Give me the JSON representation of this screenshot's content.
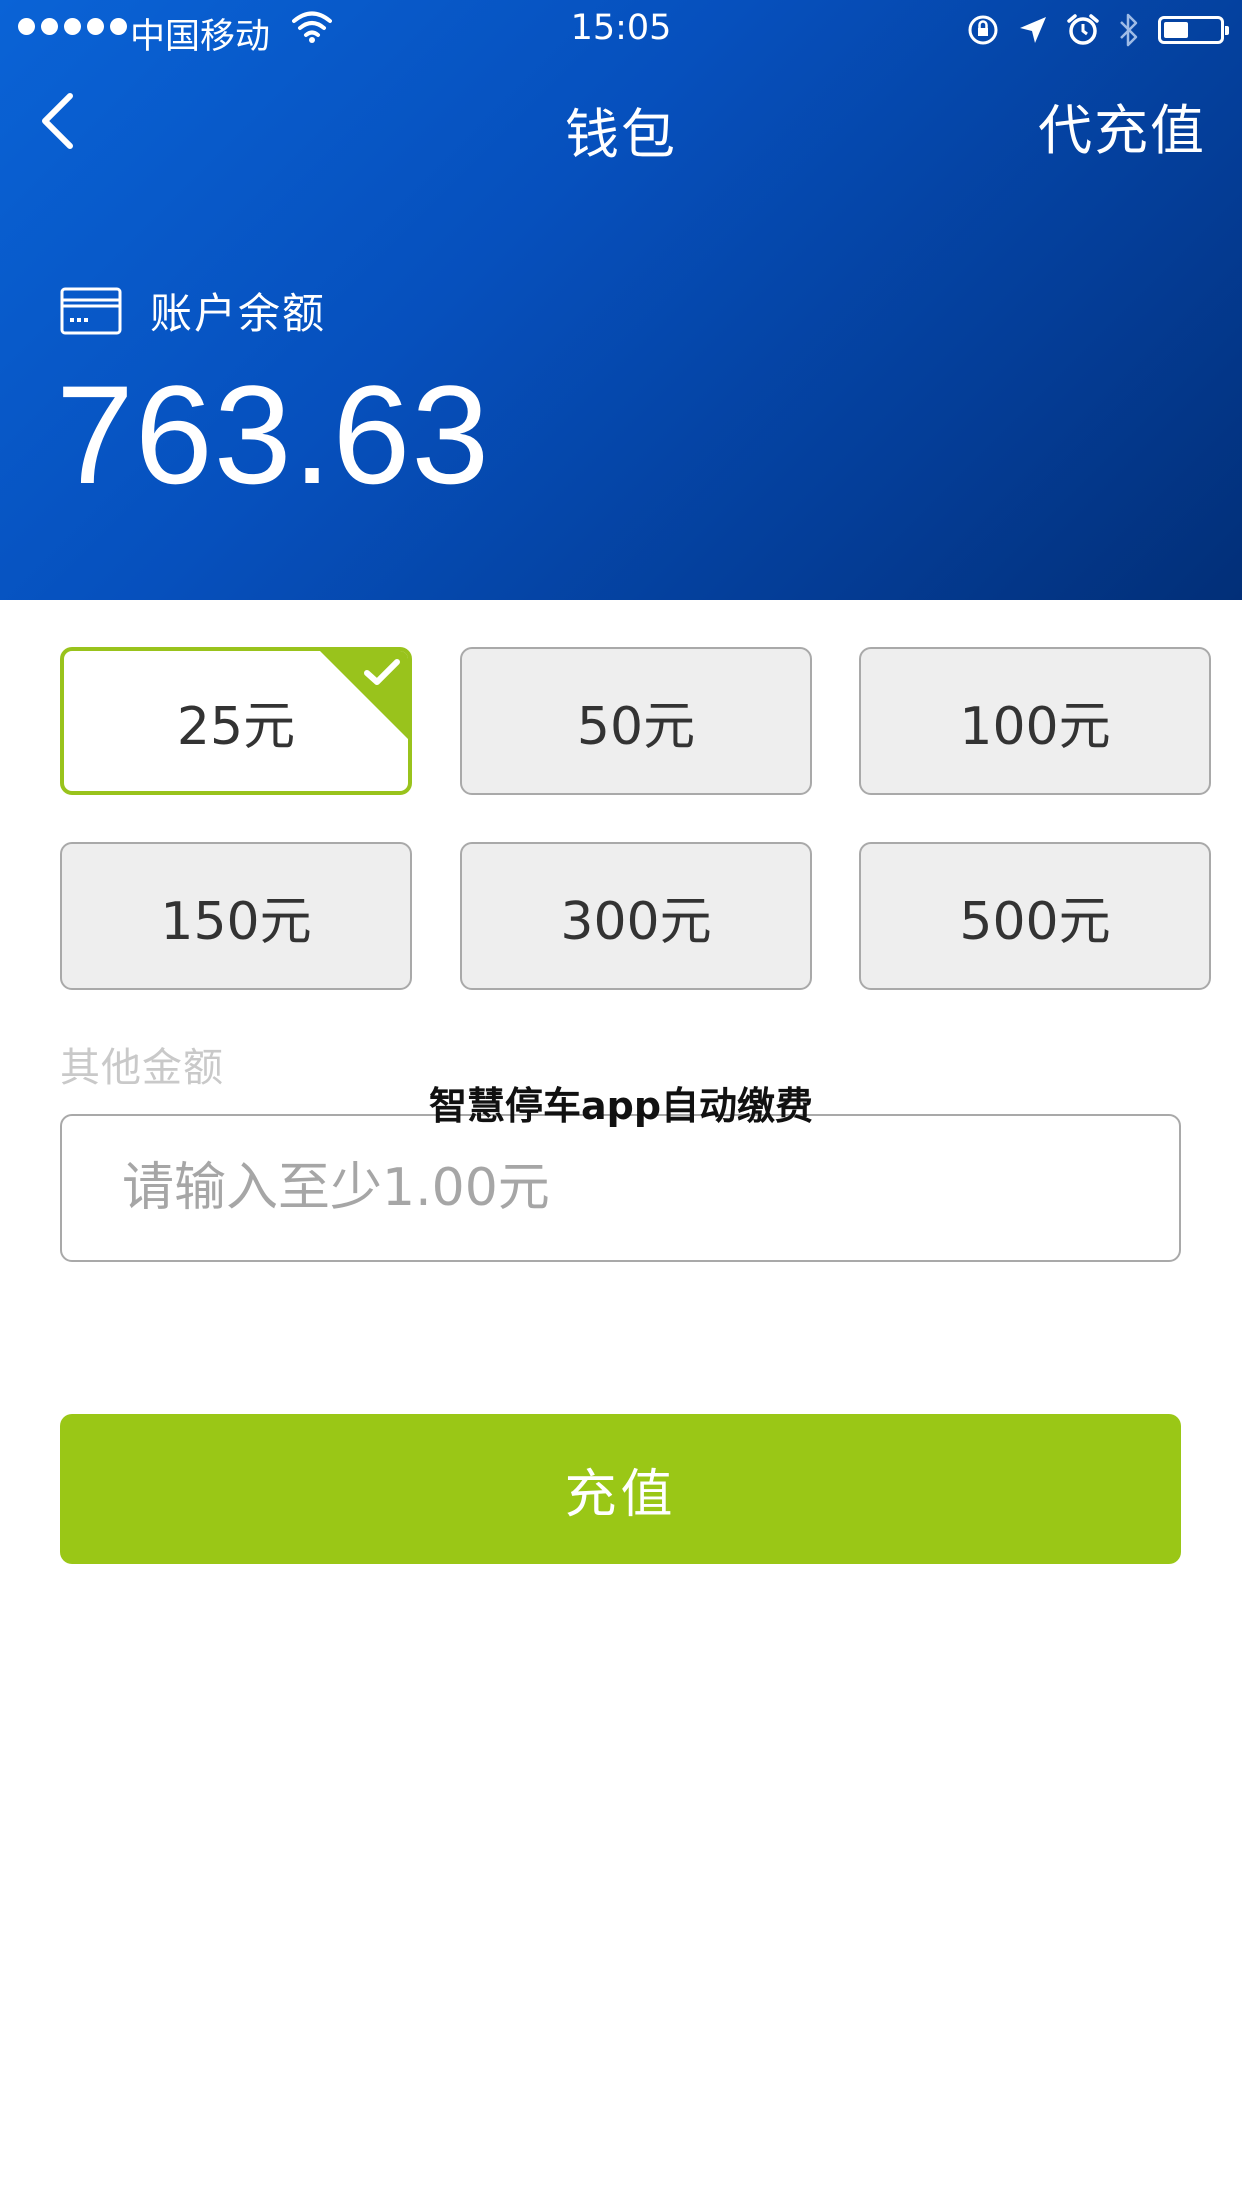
{
  "status_bar": {
    "carrier": "中国移动",
    "time": "15:05",
    "icons": [
      "signal-dots",
      "wifi-icon",
      "orientation-lock-icon",
      "location-arrow-icon",
      "alarm-icon",
      "bluetooth-icon",
      "battery-icon"
    ]
  },
  "nav": {
    "back_icon": "chevron-left-icon",
    "title": "钱包",
    "right_action": "代充值"
  },
  "balance": {
    "icon": "card-icon",
    "label": "账户余额",
    "value": "763.63"
  },
  "amount_options": [
    {
      "label": "25元",
      "selected": true
    },
    {
      "label": "50元",
      "selected": false
    },
    {
      "label": "100元",
      "selected": false
    },
    {
      "label": "150元",
      "selected": false
    },
    {
      "label": "300元",
      "selected": false
    },
    {
      "label": "500元",
      "selected": false
    }
  ],
  "other_amount": {
    "label": "其他金额",
    "placeholder": "请输入至少1.00元",
    "value": ""
  },
  "watermark": "智慧停车app自动缴费",
  "recharge_button": "充值",
  "colors": {
    "header_gradient_start": "#0a63d6",
    "header_gradient_end": "#022f78",
    "accent_green": "#9ac716",
    "option_bg": "#eeeeee",
    "option_border": "#a9a9a9"
  }
}
